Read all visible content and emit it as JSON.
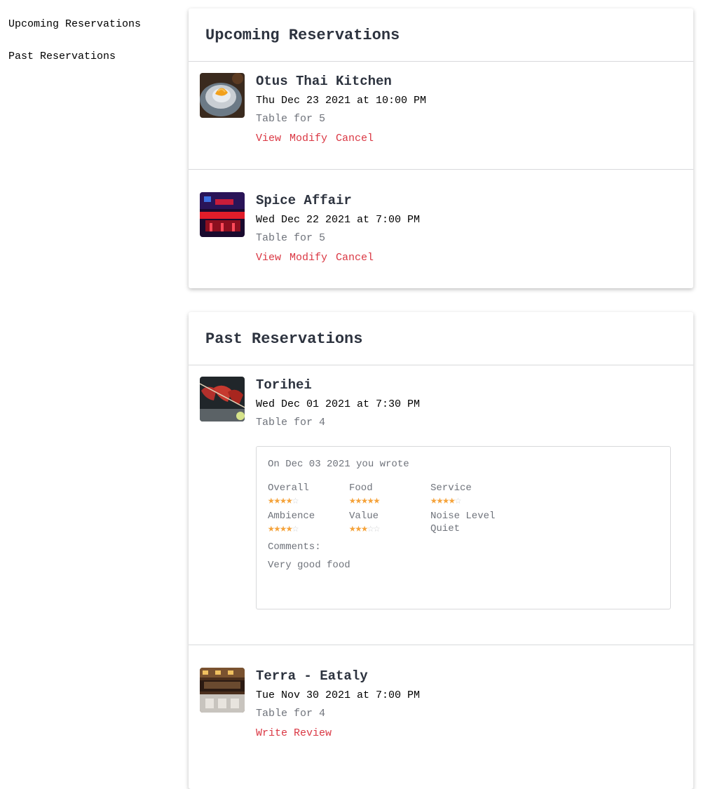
{
  "sidebar": {
    "links": [
      "Upcoming Reservations",
      "Past Reservations"
    ]
  },
  "upcoming": {
    "title": "Upcoming Reservations",
    "items": [
      {
        "name": "Otus Thai Kitchen",
        "date": "Thu Dec 23 2021 at 10:00 PM",
        "party": "Table for 5",
        "actions": [
          "View",
          "Modify",
          "Cancel"
        ]
      },
      {
        "name": "Spice Affair",
        "date": "Wed Dec 22 2021 at 7:00 PM",
        "party": "Table for 5",
        "actions": [
          "View",
          "Modify",
          "Cancel"
        ]
      }
    ]
  },
  "past": {
    "title": "Past Reservations",
    "items": [
      {
        "name": "Torihei",
        "date": "Wed Dec 01 2021 at 7:30 PM",
        "party": "Table for 4",
        "review": {
          "header": "On Dec 03 2021 you wrote",
          "ratings": {
            "overall": {
              "label": "Overall",
              "stars": 4
            },
            "food": {
              "label": "Food",
              "stars": 5
            },
            "service": {
              "label": "Service",
              "stars": 4
            },
            "ambience": {
              "label": "Ambience",
              "stars": 4
            },
            "value": {
              "label": "Value",
              "stars": 3
            }
          },
          "noise": {
            "label": "Noise Level",
            "value": "Quiet"
          },
          "comments_label": "Comments:",
          "comments": "Very good food"
        }
      },
      {
        "name": "Terra - Eataly",
        "date": "Tue Nov 30 2021 at 7:00 PM",
        "party": "Table for 4",
        "action": "Write Review"
      }
    ]
  },
  "colors": {
    "accent": "#da3743",
    "star": "#f5a33b",
    "muted": "#6f737b",
    "divider": "#d8d9db"
  }
}
